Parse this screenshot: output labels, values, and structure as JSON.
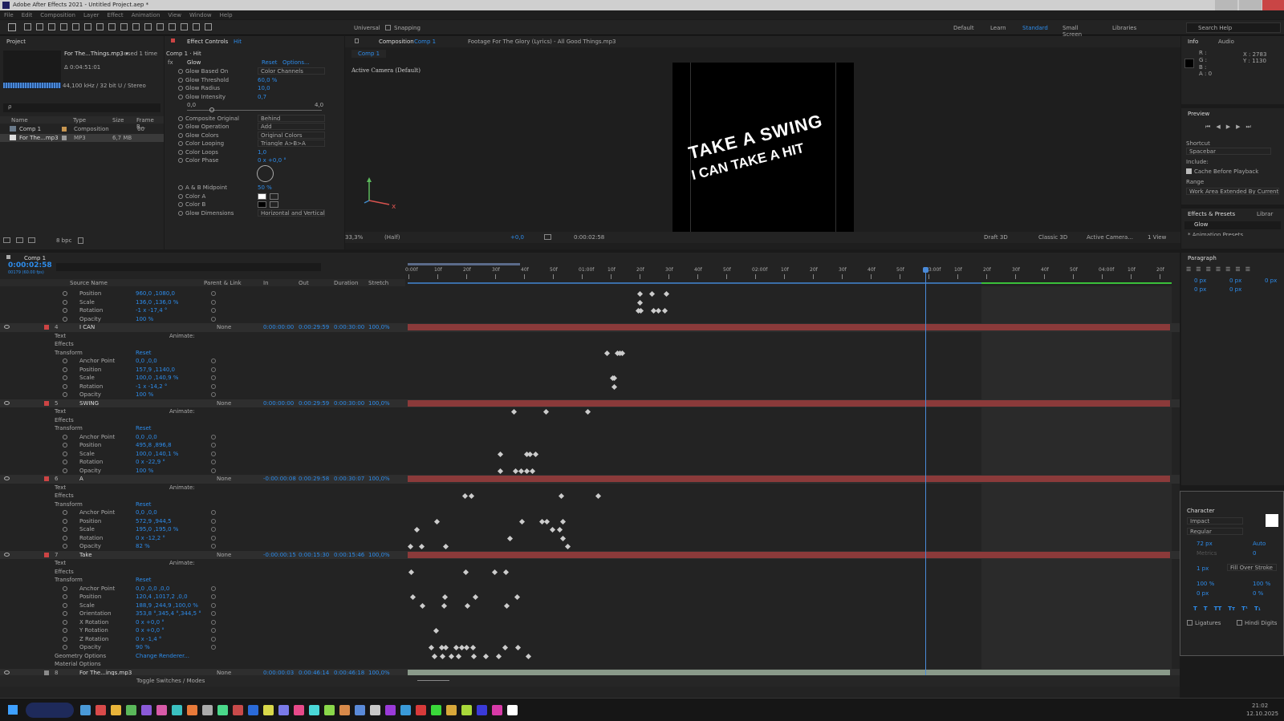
{
  "app": {
    "title": "Adobe After Effects 2021 - Untitled Project.aep *",
    "menus": [
      "File",
      "Edit",
      "Composition",
      "Layer",
      "Effect",
      "Animation",
      "View",
      "Window",
      "Help"
    ]
  },
  "toolbar": {
    "universal": "Universal",
    "snapping": "Snapping",
    "workspaces": [
      "Default",
      "Learn",
      "Standard",
      "Small Screen",
      "Libraries"
    ],
    "active_workspace": "Standard",
    "search": "Search Help"
  },
  "project": {
    "tab": "Project",
    "selected_name": "For The...Things.mp3 ▾",
    "used": ", used 1 time",
    "duration": "Δ 0:04:51:01",
    "audio_info": "44,100 kHz / 32 bit U / Stereo",
    "search_placeholder": "ρ",
    "columns": [
      "Name",
      "Type",
      "Size",
      "Frame R..."
    ],
    "items": [
      {
        "name": "Comp 1",
        "type": "Composition",
        "size": "",
        "rate": "60"
      },
      {
        "name": "For The...mp3",
        "type": "MP3",
        "size": "6,7 MB",
        "rate": ""
      }
    ],
    "bpc": "8 bpc"
  },
  "effect_controls": {
    "tab": "Effect Controls",
    "tab_target": "Hit",
    "title": "Comp 1 · Hit",
    "fx_name": "Glow",
    "reset": "Reset",
    "options": "Options...",
    "props": [
      {
        "name": "Glow Based On",
        "type": "dd",
        "value": "Color Channels"
      },
      {
        "name": "Glow Threshold",
        "type": "val",
        "value": "60,0 %"
      },
      {
        "name": "Glow Radius",
        "type": "val",
        "value": "10,0"
      },
      {
        "name": "Glow Intensity",
        "type": "val",
        "value": "0,7"
      },
      {
        "name": "",
        "type": "slider",
        "min": "0,0",
        "max": "4,0"
      },
      {
        "name": "Composite Original",
        "type": "dd",
        "value": "Behind"
      },
      {
        "name": "Glow Operation",
        "type": "dd",
        "value": "Add"
      },
      {
        "name": "Glow Colors",
        "type": "dd",
        "value": "Original Colors"
      },
      {
        "name": "Color Looping",
        "type": "dd",
        "value": "Triangle A>B>A"
      },
      {
        "name": "Color Loops",
        "type": "val",
        "value": "1,0"
      },
      {
        "name": "Color Phase",
        "type": "val",
        "value": "0 x +0,0 °"
      },
      {
        "name": "A & B Midpoint",
        "type": "val",
        "value": "50 %"
      },
      {
        "name": "Color A",
        "type": "color",
        "value": ""
      },
      {
        "name": "Color B",
        "type": "color",
        "value": ""
      },
      {
        "name": "Glow Dimensions",
        "type": "dd",
        "value": "Horizontal and Vertical"
      }
    ]
  },
  "composition": {
    "tab": "Composition",
    "tab_target": "Comp 1",
    "footage_tab": "Footage For The Glory (Lyrics) - All Good Things.mp3",
    "subtab": "Comp 1",
    "camera_label": "Active Camera (Default)",
    "text_line1": "TAKE A SWING",
    "text_line2": "I CAN TAKE A HIT",
    "zoom": "33,3%",
    "resolution": "(Half)",
    "exposure": "+0,0",
    "timecode": "0:00:02:58",
    "renderer": "Draft 3D",
    "classic": "Classic 3D",
    "camera": "Active Camera...",
    "view": "1 View"
  },
  "info": {
    "tabs": [
      "Info",
      "Audio"
    ],
    "r": "R :",
    "g": "G :",
    "b": "B :",
    "a": "A : 0",
    "x": "X : 2783",
    "y": "Y : 1130"
  },
  "preview": {
    "tab": "Preview",
    "shortcut_label": "Shortcut",
    "shortcut": "Spacebar",
    "include": "Include:",
    "cache": "Cache Before Playback",
    "range_label": "Range",
    "range": "Work Area Extended By Current ..."
  },
  "effects_presets": {
    "tabs": [
      "Effects & Presets",
      "Librar"
    ],
    "search": "Glow",
    "item": "* Animation Presets"
  },
  "paragraph": {
    "tab": "Paragraph",
    "indent": [
      "0 px",
      "0 px",
      "0 px",
      "0 px",
      "0 px"
    ]
  },
  "character": {
    "tab": "Character",
    "font": "Impact",
    "style": "Regular",
    "size": "72 px",
    "leading": "Auto",
    "kerning": "Metrics",
    "tracking": "0",
    "stroke": "1 px",
    "stroke_type": "Fill Over Stroke",
    "vscale": "100 %",
    "hscale": "100 %",
    "baseline": "0 px",
    "tsume": "0 %",
    "ligatures": "Ligatures",
    "hindi": "Hindi Digits"
  },
  "timeline": {
    "tab": "Comp 1",
    "timecode": "0:00:02:58",
    "frame_info": "00179 (60.00 fps)",
    "cols": [
      "Source Name",
      "Parent & Link",
      "In",
      "Out",
      "Duration",
      "Stretch"
    ],
    "ruler": [
      "0:00f",
      "10f",
      "20f",
      "30f",
      "40f",
      "50f",
      "01:00f",
      "10f",
      "20f",
      "30f",
      "40f",
      "50f",
      "02:00f",
      "10f",
      "20f",
      "30f",
      "40f",
      "50f",
      "03:00f",
      "10f",
      "20f",
      "30f",
      "40f",
      "50f",
      "04:00f",
      "10f",
      "20f"
    ],
    "toggle": "Toggle Switches / Modes",
    "rows": [
      {
        "k": "p",
        "name": "Position",
        "val": "960,0 ,1080,0"
      },
      {
        "k": "p",
        "name": "Scale",
        "val": "136,0 ,136,0 %"
      },
      {
        "k": "p",
        "name": "Rotation",
        "val": "-1 x -17,4 °"
      },
      {
        "k": "p",
        "name": "Opacity",
        "val": "100 %"
      },
      {
        "k": "L",
        "num": "4",
        "name": "I CAN",
        "parent": "None",
        "in": "0:00:00:00",
        "out": "0:00:29:59",
        "dur": "0:00:30:00",
        "str": "100,0%"
      },
      {
        "k": "g",
        "name": "Text",
        "animate": "Animate:"
      },
      {
        "k": "g",
        "name": "Effects"
      },
      {
        "k": "g",
        "name": "Transform",
        "reset": "Reset"
      },
      {
        "k": "p",
        "name": "Anchor Point",
        "val": "0,0 ,0,0"
      },
      {
        "k": "p",
        "name": "Position",
        "val": "157,9 ,1140,0"
      },
      {
        "k": "p",
        "name": "Scale",
        "val": "100,0 ,140,9 %"
      },
      {
        "k": "p",
        "name": "Rotation",
        "val": "-1 x -14,2 °"
      },
      {
        "k": "p",
        "name": "Opacity",
        "val": "100 %"
      },
      {
        "k": "L",
        "num": "5",
        "name": "SWING",
        "parent": "None",
        "in": "0:00:00:00",
        "out": "0:00:29:59",
        "dur": "0:00:30:00",
        "str": "100,0%"
      },
      {
        "k": "g",
        "name": "Text",
        "animate": "Animate:"
      },
      {
        "k": "g",
        "name": "Effects"
      },
      {
        "k": "g",
        "name": "Transform",
        "reset": "Reset"
      },
      {
        "k": "p",
        "name": "Anchor Point",
        "val": "0,0 ,0,0"
      },
      {
        "k": "p",
        "name": "Position",
        "val": "495,8 ,896,8"
      },
      {
        "k": "p",
        "name": "Scale",
        "val": "100,0 ,140,1 %"
      },
      {
        "k": "p",
        "name": "Rotation",
        "val": "0 x -22,9 °"
      },
      {
        "k": "p",
        "name": "Opacity",
        "val": "100 %"
      },
      {
        "k": "L",
        "num": "6",
        "name": "A",
        "parent": "None",
        "in": "-0:00:00:08",
        "out": "0:00:29:58",
        "dur": "0:00:30:07",
        "str": "100,0%"
      },
      {
        "k": "g",
        "name": "Text",
        "animate": "Animate:"
      },
      {
        "k": "g",
        "name": "Effects"
      },
      {
        "k": "g",
        "name": "Transform",
        "reset": "Reset"
      },
      {
        "k": "p",
        "name": "Anchor Point",
        "val": "0,0 ,0,0"
      },
      {
        "k": "p",
        "name": "Position",
        "val": "572,9 ,944,5"
      },
      {
        "k": "p",
        "name": "Scale",
        "val": "195,0 ,195,0 %"
      },
      {
        "k": "p",
        "name": "Rotation",
        "val": "0 x -12,2 °"
      },
      {
        "k": "p",
        "name": "Opacity",
        "val": "82 %"
      },
      {
        "k": "L",
        "num": "7",
        "name": "Take",
        "parent": "None",
        "in": "-0:00:00:15",
        "out": "0:00:15:30",
        "dur": "0:00:15:46",
        "str": "100,0%"
      },
      {
        "k": "g",
        "name": "Text",
        "animate": "Animate:"
      },
      {
        "k": "g",
        "name": "Effects"
      },
      {
        "k": "g",
        "name": "Transform",
        "reset": "Reset"
      },
      {
        "k": "p",
        "name": "Anchor Point",
        "val": "0,0 ,0,0 ,0,0"
      },
      {
        "k": "p",
        "name": "Position",
        "val": "120,4 ,1017,2 ,0,0"
      },
      {
        "k": "p",
        "name": "Scale",
        "val": "188,9 ,244,9 ,100,0 %"
      },
      {
        "k": "p",
        "name": "Orientation",
        "val": "353,8 °,345,4 °,344,5 °"
      },
      {
        "k": "p",
        "name": "X Rotation",
        "val": "0 x +0,0 °"
      },
      {
        "k": "p",
        "name": "Y Rotation",
        "val": "0 x +0,0 °"
      },
      {
        "k": "p",
        "name": "Z Rotation",
        "val": "0 x -1,4 °"
      },
      {
        "k": "p",
        "name": "Opacity",
        "val": "90 %"
      },
      {
        "k": "g",
        "name": "Geometry Options",
        "reset": "Change Renderer..."
      },
      {
        "k": "g",
        "name": "Material Options"
      },
      {
        "k": "L",
        "num": "8",
        "name": "For The...ings.mp3",
        "parent": "None",
        "in": "0:00:00:03",
        "out": "0:00:46:14",
        "dur": "0:00:46:18",
        "str": "100,0%"
      }
    ]
  },
  "taskbar": {
    "time": "21:02",
    "date": "12.10.2025"
  }
}
